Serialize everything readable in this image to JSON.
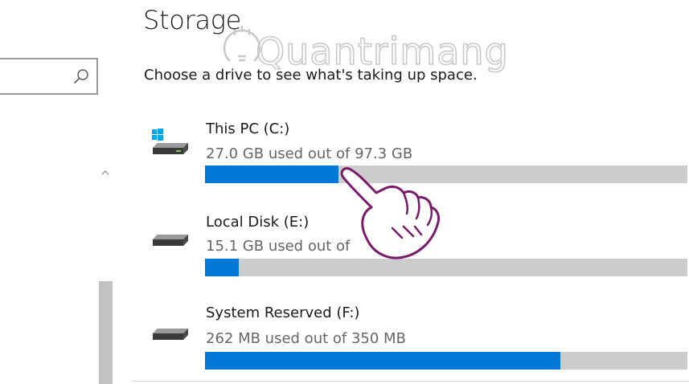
{
  "page": {
    "title": "Storage",
    "subtitle": "Choose a drive to see what's taking up space."
  },
  "search": {
    "value": "",
    "placeholder": "",
    "icon": "search-icon"
  },
  "watermark": {
    "text": "Quantrimang"
  },
  "drives": [
    {
      "name": "This PC (C:)",
      "usage": "27.0 GB used out of 97.3 GB",
      "used_fraction": 0.277,
      "icon": "system-drive-icon"
    },
    {
      "name": "Local Disk (E:)",
      "usage": "15.1 GB used out of",
      "used_fraction": 0.07,
      "icon": "hard-drive-icon"
    },
    {
      "name": "System Reserved (F:)",
      "usage": "262 MB used out of 350 MB",
      "used_fraction": 0.737,
      "icon": "hard-drive-icon"
    }
  ],
  "colors": {
    "accent": "#0078d7",
    "bar_track": "#cccccc",
    "windows_logo": "#00a4ef",
    "watermark": "#c9c9c9",
    "cursor_outline": "#7a1a6a"
  }
}
